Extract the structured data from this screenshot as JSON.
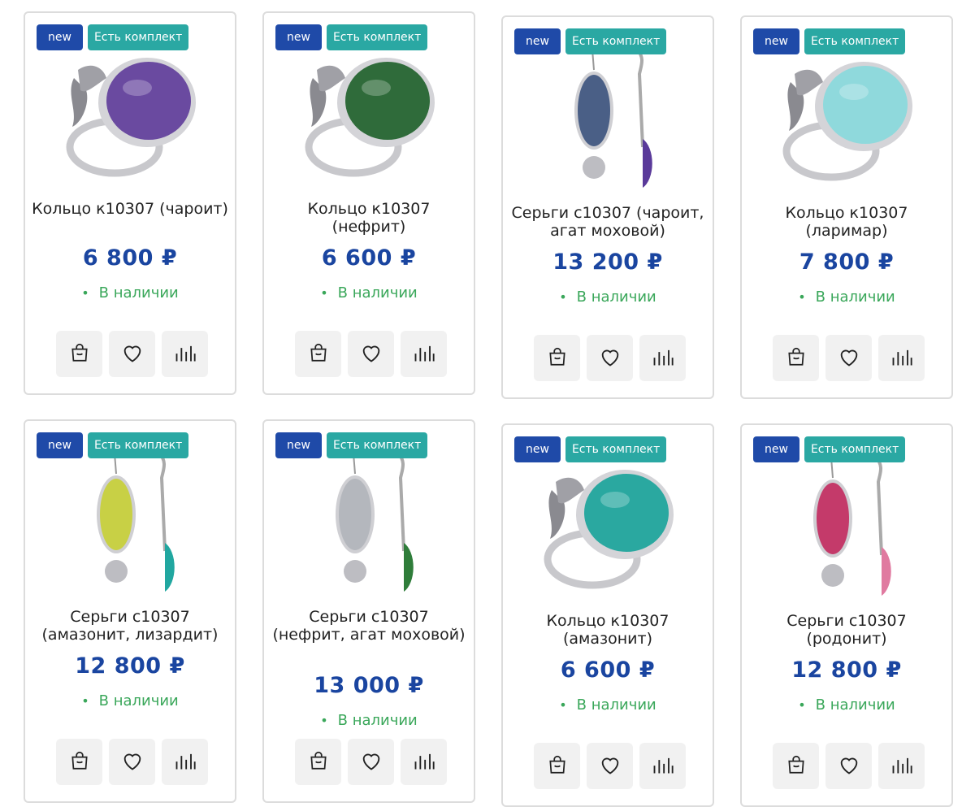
{
  "badges": {
    "new": "new",
    "set": "Есть комплект"
  },
  "stock_label": "В наличии",
  "colors": {
    "price": "#1a45a0",
    "badge_new": "#1f4aa8",
    "badge_set": "#2aa8a3",
    "stock": "#3aa75a"
  },
  "products": [
    {
      "title": "Кольцо к10307 (чароит)",
      "price": "6 800 ₽",
      "kind": "ring",
      "stone": "#6a4aa0"
    },
    {
      "title": "Кольцо к10307 (нефрит)",
      "price": "6 600 ₽",
      "kind": "ring",
      "stone": "#2f6b3a"
    },
    {
      "title": "Серьги с10307 (чароит, агат моховой)",
      "price": "13 200 ₽",
      "kind": "earring",
      "stone": "#4a5f86",
      "stone2": "#5a3a9a"
    },
    {
      "title": "Кольцо к10307 (ларимар)",
      "price": "7 800 ₽",
      "kind": "ring",
      "stone": "#8fd9dc"
    },
    {
      "title": "Серьги с10307 (амазонит, лизардит)",
      "price": "12 800 ₽",
      "kind": "earring",
      "stone": "#c8d045",
      "stone2": "#21a7a0"
    },
    {
      "title": "Серьги с10307 (нефрит, агат моховой)",
      "price": "13 000 ₽",
      "kind": "earring",
      "stone": "#b4b7bd",
      "stone2": "#2f7d3a"
    },
    {
      "title": "Кольцо к10307 (амазонит)",
      "price": "6 600 ₽",
      "kind": "ring",
      "stone": "#2aa8a0"
    },
    {
      "title": "Серьги с10307 (родонит)",
      "price": "12 800 ₽",
      "kind": "earring",
      "stone": "#c43a6a",
      "stone2": "#e07aa0"
    }
  ]
}
